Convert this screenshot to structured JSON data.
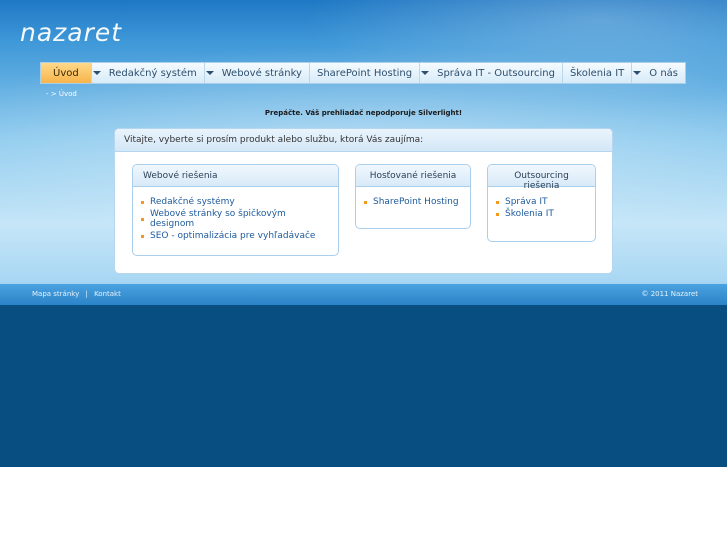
{
  "brand": {
    "logo": "nazaret"
  },
  "nav": {
    "items": [
      {
        "label": "Úvod",
        "active": true
      },
      {
        "label": "Redakčný systém",
        "dropdown": true
      },
      {
        "label": "Webové stránky",
        "dropdown": true
      },
      {
        "label": "SharePoint Hosting"
      },
      {
        "label": "Správa IT - Outsourcing",
        "dropdown": true
      },
      {
        "label": "Školenia IT"
      },
      {
        "label": "O nás",
        "dropdown": true
      }
    ]
  },
  "breadcrumb": "- > Úvod",
  "notice": "Prepáčte. Váš prehliadač nepodporuje Silverlight!",
  "panel": {
    "header": "Vitajte, vyberte si prosím produkt alebo službu, ktorá Vás zaujíma:",
    "cards": {
      "web": {
        "title": "Webové riešenia",
        "items": [
          "Redakčné systémy",
          "Webové stránky so špičkovým designom",
          "SEO - optimalizácia pre vyhľadávače"
        ]
      },
      "host": {
        "title": "Hosťované riešenia",
        "items": [
          "SharePoint Hosting"
        ]
      },
      "out": {
        "title": "Outsourcing riešenia",
        "items": [
          "Správa IT",
          "Školenia IT"
        ]
      }
    }
  },
  "footer": {
    "links": [
      "Mapa stránky",
      "Kontakt"
    ],
    "separator": "|",
    "copyright": "© 2011 Nazaret"
  },
  "colors": {
    "accent": "#f7b44b",
    "link": "#1d5a9c",
    "deep_background": "#084e80"
  }
}
